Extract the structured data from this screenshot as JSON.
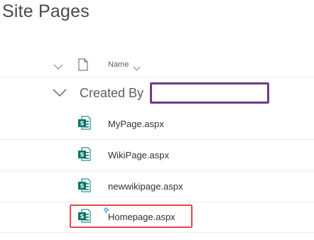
{
  "page": {
    "title": "Site Pages"
  },
  "header": {
    "name_column": "Name"
  },
  "group": {
    "label": "Created By",
    "value": ""
  },
  "files": [
    {
      "name": "MyPage.aspx"
    },
    {
      "name": "WikiPage.aspx"
    },
    {
      "name": "newwikipage.aspx"
    },
    {
      "name": "Homepage.aspx"
    }
  ],
  "icons": {
    "select_all": "chevron-down-icon",
    "file_type": "document-icon",
    "sort": "chevron-down-icon",
    "group_toggle": "chevron-down-icon",
    "site_page": "sharepoint-page-icon",
    "new_item": "new-item-marker-icon"
  },
  "colors": {
    "sharepoint_green": "#077568",
    "group_box_border": "#6f3a8f",
    "highlight_border": "#e8474f"
  }
}
